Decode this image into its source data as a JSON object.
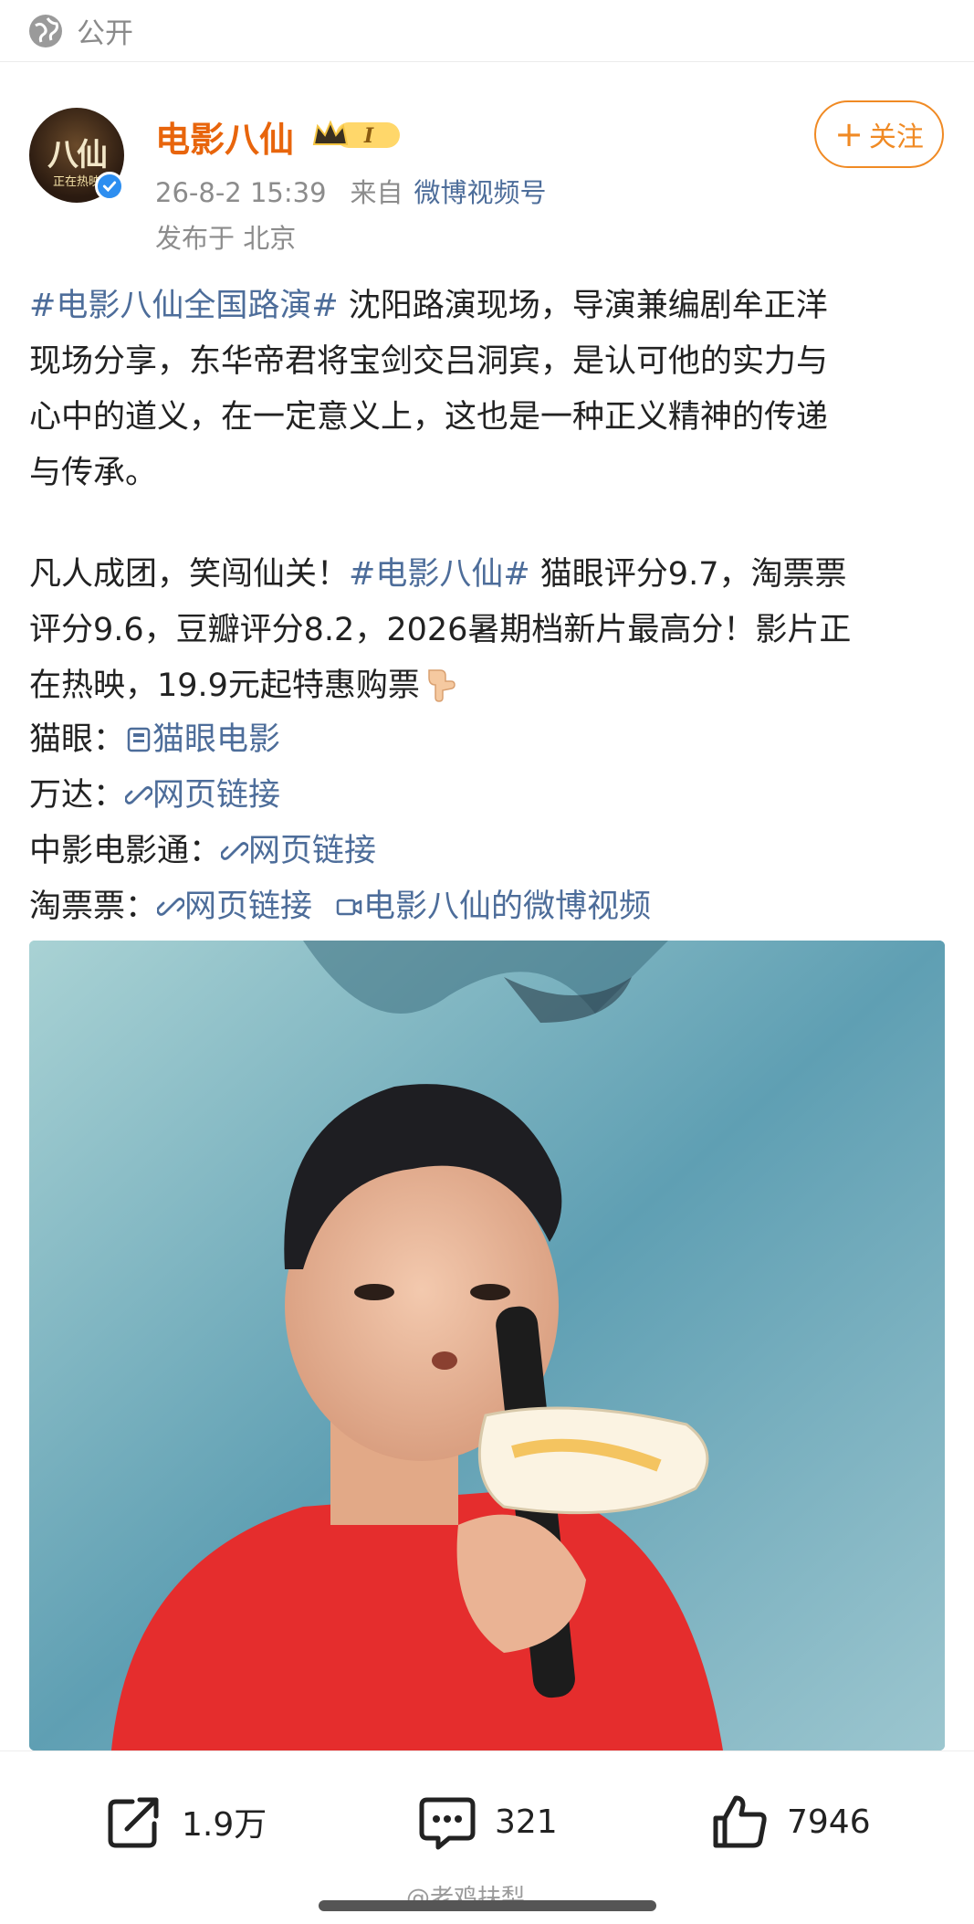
{
  "visibility": {
    "label": "公开",
    "icon": "globe-icon"
  },
  "author": {
    "name": "电影八仙",
    "avatar_title": "八仙",
    "avatar_subtitle": "正在热映",
    "vip_level": "I",
    "follow_label": "关注",
    "follow_plus": "+"
  },
  "meta": {
    "time": "26-8-2 15:39",
    "source_label": "来自",
    "source": "微博视频号",
    "location": "发布于 北京"
  },
  "post": {
    "p1": {
      "tag": "#电影八仙全国路演#",
      "line1_rest": " 沈阳路演现场，导演兼编剧牟正洋",
      "line2": "现场分享，东华帝君将宝剑交吕洞宾，是认可他的实力与",
      "line3": "心中的道义，在一定意义上，这也是一种正义精神的传递",
      "line4": "与传承。"
    },
    "p2": {
      "line1_pre": "凡人成团，笑闯仙关！",
      "line1_tag": "#电影八仙#",
      "line1_post": " 猫眼评分9.7，淘票票",
      "line2": "评分9.6，豆瓣评分8.2，2026暑期档新片最高分！影片正",
      "line3": "在热映，19.9元起特惠购票"
    },
    "links": {
      "maoyan_label": "猫眼：",
      "maoyan_link": "猫眼电影",
      "wanda_label": "万达：",
      "wanda_link": "网页链接",
      "zhongying_label": "中影电影通：",
      "zhongying_link": "网页链接",
      "taopiaopiao_label": "淘票票：",
      "taopiaopiao_link": "网页链接",
      "video_link": "电影八仙的微博视频"
    }
  },
  "actions": {
    "share_count": "1.9万",
    "comment_count": "321",
    "like_count": "7946"
  },
  "watermark": "@老鸡扶梨",
  "colors": {
    "username": "#e8650c",
    "follow": "#f08a24",
    "link": "#4d6d9a",
    "meta": "#8c8c8c"
  }
}
